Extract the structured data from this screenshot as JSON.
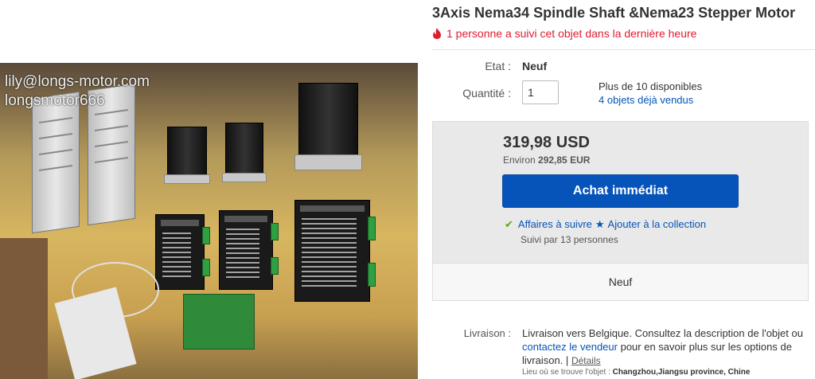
{
  "image": {
    "watermark_line1": "lily@longs-motor.com",
    "watermark_line2": "longsmotor666"
  },
  "listing": {
    "title": "3Axis Nema34 Spindle Shaft &Nema23 Stepper Motor",
    "watch_notice": "1 personne a suivi cet objet dans la dernière heure",
    "condition_label": "Etat :",
    "condition_value": "Neuf",
    "quantity_label": "Quantité :",
    "quantity_value": "1",
    "availability": "Plus de 10 disponibles",
    "sold": "4 objets déjà vendus",
    "price": "319,98 USD",
    "approx_prefix": "Environ",
    "approx_value": "292,85 EUR",
    "buy_button": "Achat immédiat",
    "follow_link": "Affaires à suivre",
    "collection_link": "Ajouter à la collection",
    "followers": "Suivi par 13 personnes",
    "condition_box": "Neuf",
    "shipping_label": "Livraison :",
    "shipping_text_1": "Livraison vers Belgique. Consultez la description de l'objet ou",
    "shipping_link": "contactez le vendeur",
    "shipping_text_2": "pour en savoir plus sur les options de livraison.",
    "shipping_sep": "|",
    "shipping_details": "Détails",
    "location_prefix": "Lieu où se trouve l'objet :",
    "location_value": "Changzhou,Jiangsu province, Chine"
  },
  "colors": {
    "link": "#0654ba",
    "buy_button": "#0654ba",
    "alert_red": "#dd1e31",
    "check_green": "#5ba71b"
  },
  "icons": {
    "watch_notice": "fire-icon",
    "follow": "checkmark-icon",
    "collection": "star-icon"
  }
}
